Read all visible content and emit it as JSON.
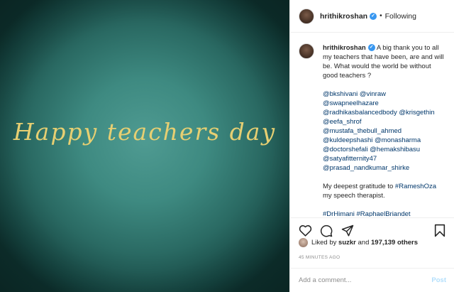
{
  "image": {
    "caption_text": "Happy teachers day"
  },
  "header": {
    "username": "hrithikroshan",
    "separator": "•",
    "follow_status": "Following"
  },
  "caption": {
    "username": "hrithikroshan",
    "text": "A big thank you to all my teachers that have been, are and will be. What would the world be without good teachers ?",
    "mention_lines": [
      [
        "@bkshivani",
        "@vinraw"
      ],
      [
        "@swapneelhazare"
      ],
      [
        "@radhikasbalancedbody",
        "@krisgethin"
      ],
      [
        "@eefa_shrof"
      ],
      [
        "@mustafa_thebull_ahmed"
      ],
      [
        "@kuldeepshashi",
        "@monasharma"
      ],
      [
        "@doctorshefali",
        "@hemakshibasu"
      ],
      [
        "@satyafitternity47"
      ],
      [
        "@prasad_nandkumar_shirke"
      ]
    ],
    "gratitude_prefix": "My deepest gratitude to ",
    "gratitude_tag": "#RameshOza",
    "gratitude_suffix": " my speech therapist.",
    "hashtags": [
      "#DrHimani",
      "#RaphaelBriandet"
    ]
  },
  "actions": {
    "icons": [
      "heart-icon",
      "comment-icon",
      "share-icon",
      "bookmark-icon"
    ]
  },
  "likes": {
    "prefix": "Liked by ",
    "user": "suzkr",
    "middle": " and ",
    "count": "197,139 others"
  },
  "timestamp": "45 MINUTES AGO",
  "comment_box": {
    "placeholder": "Add a comment...",
    "post_label": "Post"
  },
  "colors": {
    "link": "#00376b",
    "verified": "#3897f0",
    "post_disabled": "#b2dffc",
    "image_text": "#e7cf72"
  }
}
